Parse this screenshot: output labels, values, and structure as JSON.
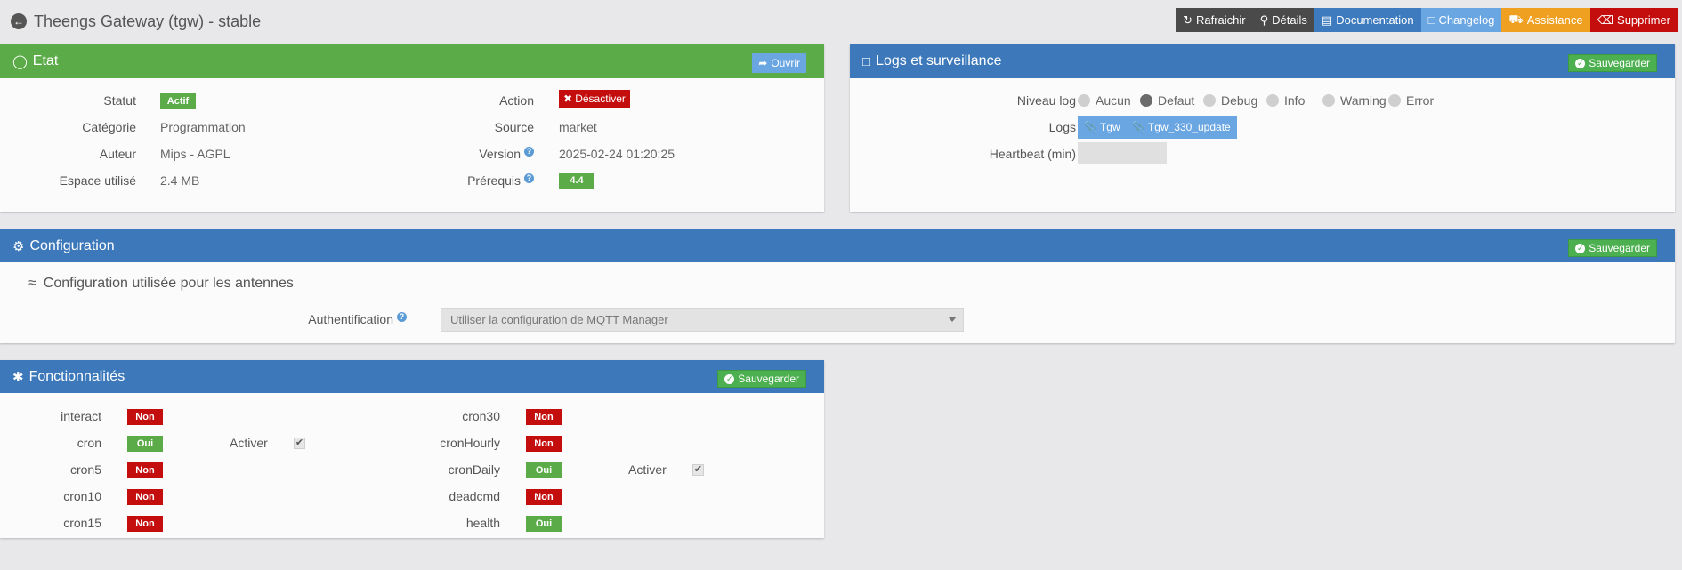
{
  "header": {
    "title": "Theengs Gateway (tgw) - stable",
    "buttons": {
      "refresh": "Rafraichir",
      "details": "Détails",
      "documentation": "Documentation",
      "changelog": "Changelog",
      "assistance": "Assistance",
      "delete": "Supprimer"
    }
  },
  "etat": {
    "title": "Etat",
    "open_label": "Ouvrir",
    "statut_label": "Statut",
    "statut_value": "Actif",
    "categorie_label": "Catégorie",
    "categorie_value": "Programmation",
    "auteur_label": "Auteur",
    "auteur_value": "Mips - AGPL",
    "espace_label": "Espace utilisé",
    "espace_value": "2.4 MB",
    "action_label": "Action",
    "action_value": "Désactiver",
    "source_label": "Source",
    "source_value": "market",
    "version_label": "Version",
    "version_value": "2025-02-24 01:20:25",
    "prerequis_label": "Prérequis",
    "prerequis_value": "4.4"
  },
  "logs": {
    "title": "Logs et surveillance",
    "save_label": "Sauvegarder",
    "niveau_label": "Niveau log",
    "levels": [
      "Aucun",
      "Defaut",
      "Debug",
      "Info",
      "Warning",
      "Error"
    ],
    "selected_level": "Defaut",
    "logs_label": "Logs",
    "log_files": [
      "Tgw",
      "Tgw_330_update"
    ],
    "heartbeat_label": "Heartbeat (min)",
    "heartbeat_value": ""
  },
  "configuration": {
    "title": "Configuration",
    "save_label": "Sauvegarder",
    "section_title": "Configuration utilisée pour les antennes",
    "auth_label": "Authentification",
    "auth_value": "Utiliser la configuration de MQTT Manager"
  },
  "fonctionnalites": {
    "title": "Fonctionnalités",
    "save_label": "Sauvegarder",
    "activer_label": "Activer",
    "left": [
      {
        "name": "interact",
        "value": "Non"
      },
      {
        "name": "cron",
        "value": "Oui"
      },
      {
        "name": "cron5",
        "value": "Non"
      },
      {
        "name": "cron10",
        "value": "Non"
      },
      {
        "name": "cron15",
        "value": "Non"
      }
    ],
    "right": [
      {
        "name": "cron30",
        "value": "Non"
      },
      {
        "name": "cronHourly",
        "value": "Non"
      },
      {
        "name": "cronDaily",
        "value": "Oui"
      },
      {
        "name": "deadcmd",
        "value": "Non"
      },
      {
        "name": "health",
        "value": "Oui"
      }
    ]
  },
  "colors": {
    "green": "#5bab48",
    "blue": "#3d79ba",
    "red": "#c40d0d",
    "orange": "#f0a020"
  }
}
